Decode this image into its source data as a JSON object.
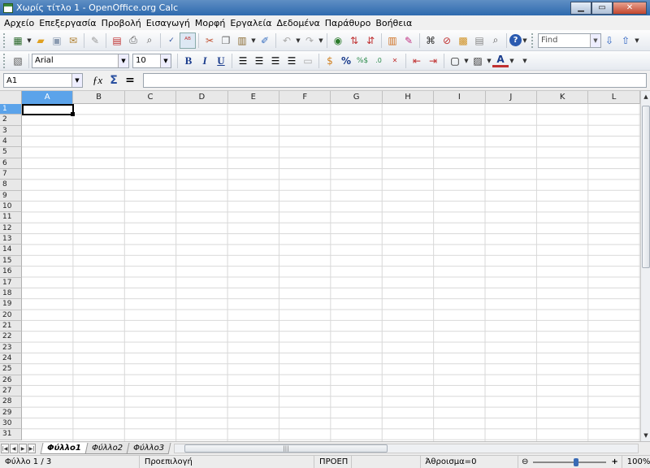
{
  "window": {
    "title": "Χωρίς τίτλο 1 - OpenOffice.org Calc"
  },
  "menu": [
    "Αρχείο",
    "Επεξεργασία",
    "Προβολή",
    "Εισαγωγή",
    "Μορφή",
    "Εργαλεία",
    "Δεδομένα",
    "Παράθυρο",
    "Βοήθεια"
  ],
  "toolbar1": {
    "find_placeholder": "Find"
  },
  "toolbar2": {
    "font_name": "Arial",
    "font_size": "10",
    "bold": "B",
    "italic": "I",
    "underline": "U",
    "percent": "%"
  },
  "formula": {
    "name_box": "A1",
    "equals": "="
  },
  "columns": [
    "A",
    "B",
    "C",
    "D",
    "E",
    "F",
    "G",
    "H",
    "I",
    "J",
    "K",
    "L"
  ],
  "rows": [
    "1",
    "2",
    "3",
    "4",
    "5",
    "6",
    "7",
    "8",
    "9",
    "10",
    "11",
    "12",
    "13",
    "14",
    "15",
    "16",
    "17",
    "18",
    "19",
    "20",
    "21",
    "22",
    "23",
    "24",
    "25",
    "26",
    "27",
    "28",
    "29",
    "30",
    "31"
  ],
  "active_cell": {
    "column": "A",
    "row": "1"
  },
  "sheets": [
    "Φύλλο1",
    "Φύλλο2",
    "Φύλλο3"
  ],
  "active_sheet": "Φύλλο1",
  "status": {
    "sheet": "Φύλλο 1 / 3",
    "style": "Προεπιλογή",
    "mode": "ΠΡΟΕΠ",
    "sum": "Άθροισμα=0",
    "zoom": "100%",
    "zoom_in": "+",
    "zoom_out": "⊖"
  },
  "colors": {
    "titlebar": "#2e6aae",
    "active_header": "#5ba3ea",
    "grid_line": "#d8d8d8"
  }
}
